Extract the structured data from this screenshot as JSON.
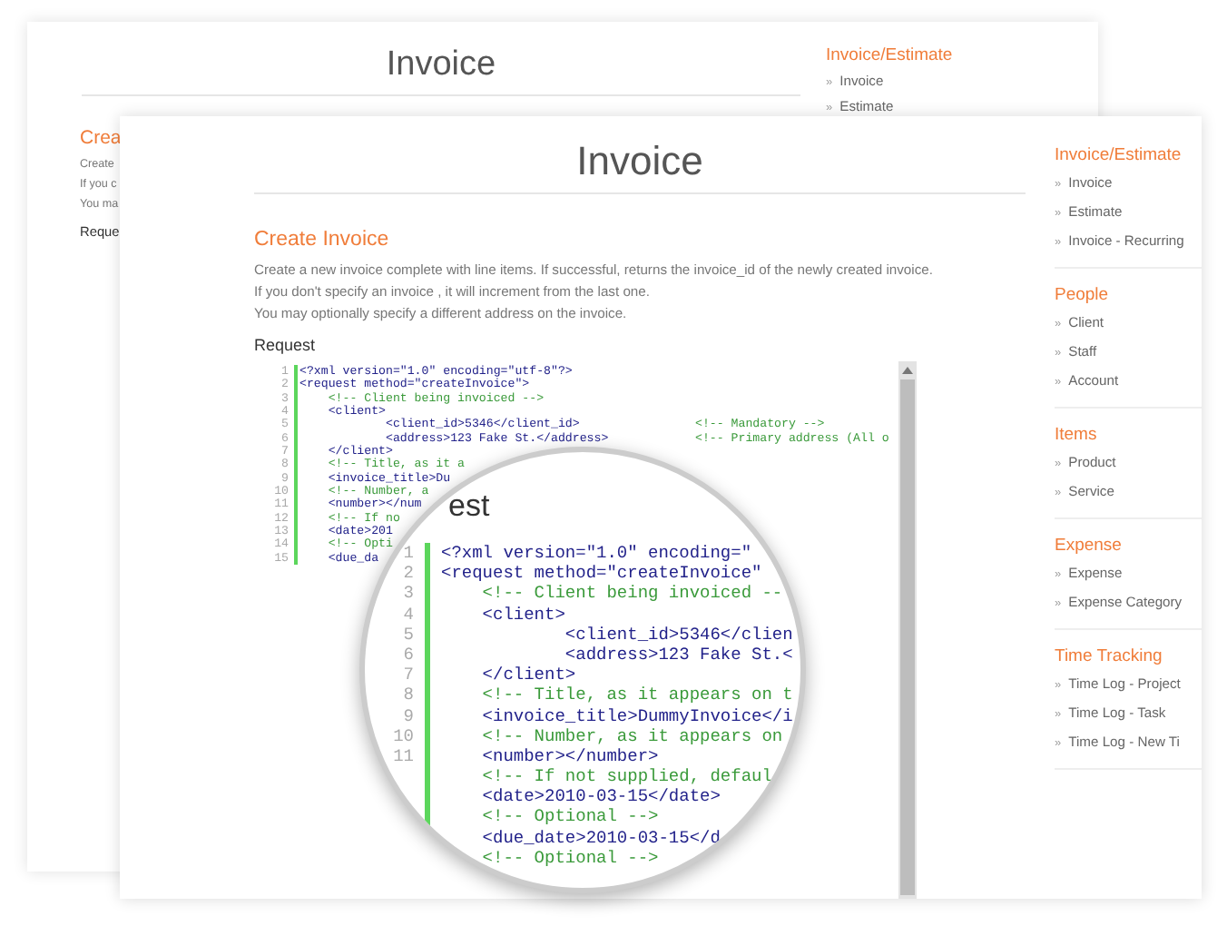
{
  "back_page": {
    "title": "Invoice",
    "sidebar_heading": "Invoice/Estimate",
    "sidebar_items": [
      {
        "marker": "»",
        "label": "Invoice"
      },
      {
        "marker": "»",
        "label": "Estimate"
      }
    ],
    "section_title": "Crea",
    "description_lines": [
      "Create",
      "If you c",
      "You ma"
    ],
    "request_label": "Reque"
  },
  "front_page": {
    "title": "Invoice",
    "section_title": "Create Invoice",
    "description_lines": [
      "Create a new invoice complete with line items. If successful, returns the invoice_id of the newly created invoice.",
      "If you don't specify an invoice , it will increment from the last one.",
      "You may optionally specify a different address on the invoice."
    ],
    "request_label": "Request",
    "code_lines": [
      {
        "number": "1",
        "kind": "tag",
        "code": "<?xml version=\"1.0\" encoding=\"utf-8\"?>"
      },
      {
        "number": "2",
        "kind": "tag",
        "code": "<request method=\"createInvoice\">"
      },
      {
        "number": "3",
        "kind": "comment",
        "code": "    <!-- Client being invoiced -->"
      },
      {
        "number": "4",
        "kind": "tag",
        "code": "    <client>"
      },
      {
        "number": "5",
        "kind": "tag",
        "code": "            <client_id>5346</client_id>",
        "comment": "<!-- Mandatory -->"
      },
      {
        "number": "6",
        "kind": "tag",
        "code": "            <address>123 Fake St.</address>",
        "comment": "<!-- Primary address (All o"
      },
      {
        "number": "7",
        "kind": "tag",
        "code": "    </client>"
      },
      {
        "number": "8",
        "kind": "comment",
        "code": "    <!-- Title, as it a"
      },
      {
        "number": "9",
        "kind": "tag",
        "code": "    <invoice_title>Du"
      },
      {
        "number": "10",
        "kind": "comment",
        "code": "    <!-- Number, a"
      },
      {
        "number": "11",
        "kind": "tag",
        "code": "    <number></num"
      },
      {
        "number": "12",
        "kind": "comment",
        "code": "    <!-- If no"
      },
      {
        "number": "13",
        "kind": "tag",
        "code": "    <date>201"
      },
      {
        "number": "14",
        "kind": "comment",
        "code": "    <!-- Opti"
      },
      {
        "number": "15",
        "kind": "tag",
        "code": "    <due_da"
      }
    ]
  },
  "sidebar": {
    "sections": [
      {
        "heading": "Invoice/Estimate",
        "items": [
          {
            "marker": "»",
            "label": "Invoice"
          },
          {
            "marker": "»",
            "label": "Estimate"
          },
          {
            "marker": "»",
            "label": "Invoice - Recurring"
          }
        ]
      },
      {
        "heading": "People",
        "items": [
          {
            "marker": "»",
            "label": "Client"
          },
          {
            "marker": "»",
            "label": "Staff"
          },
          {
            "marker": "»",
            "label": "Account"
          }
        ]
      },
      {
        "heading": "Items",
        "items": [
          {
            "marker": "»",
            "label": "Product"
          },
          {
            "marker": "»",
            "label": "Service"
          }
        ]
      },
      {
        "heading": "Expense",
        "items": [
          {
            "marker": "»",
            "label": "Expense"
          },
          {
            "marker": "»",
            "label": "Expense Category"
          }
        ]
      },
      {
        "heading": "Time Tracking",
        "items": [
          {
            "marker": "»",
            "label": "Time Log - Project"
          },
          {
            "marker": "»",
            "label": "Time Log - Task"
          },
          {
            "marker": "»",
            "label": "Time Log - New Ti"
          }
        ]
      }
    ]
  },
  "magnifier": {
    "caption": "est",
    "code_lines": [
      {
        "number": "1",
        "kind": "tag",
        "code": "<?xml version=\"1.0\" encoding=\""
      },
      {
        "number": "2",
        "kind": "tag",
        "code": "<request method=\"createInvoice\""
      },
      {
        "number": "3",
        "kind": "comment",
        "code": "    <!-- Client being invoiced --"
      },
      {
        "number": "4",
        "kind": "tag",
        "code": "    <client>"
      },
      {
        "number": "5",
        "kind": "tag",
        "code": "            <client_id>5346</clien"
      },
      {
        "number": "6",
        "kind": "tag",
        "code": "            <address>123 Fake St.<"
      },
      {
        "number": "7",
        "kind": "tag",
        "code": "    </client>"
      },
      {
        "number": "8",
        "kind": "comment",
        "code": "    <!-- Title, as it appears on t"
      },
      {
        "number": "9",
        "kind": "tag",
        "code": "    <invoice_title>DummyInvoice</i"
      },
      {
        "number": "10",
        "kind": "comment",
        "code": "    <!-- Number, as it appears on"
      },
      {
        "number": "11",
        "kind": "tag",
        "code": "    <number></number>"
      },
      {
        "kind": "comment",
        "code": "    <!-- If not supplied, defaul"
      },
      {
        "kind": "tag",
        "code": "    <date>2010-03-15</date>"
      },
      {
        "kind": "comment",
        "code": "    <!-- Optional -->"
      },
      {
        "kind": "tag",
        "code": "    <due_date>2010-03-15</d"
      },
      {
        "kind": "comment",
        "code": "    <!-- Optional -->"
      }
    ]
  }
}
